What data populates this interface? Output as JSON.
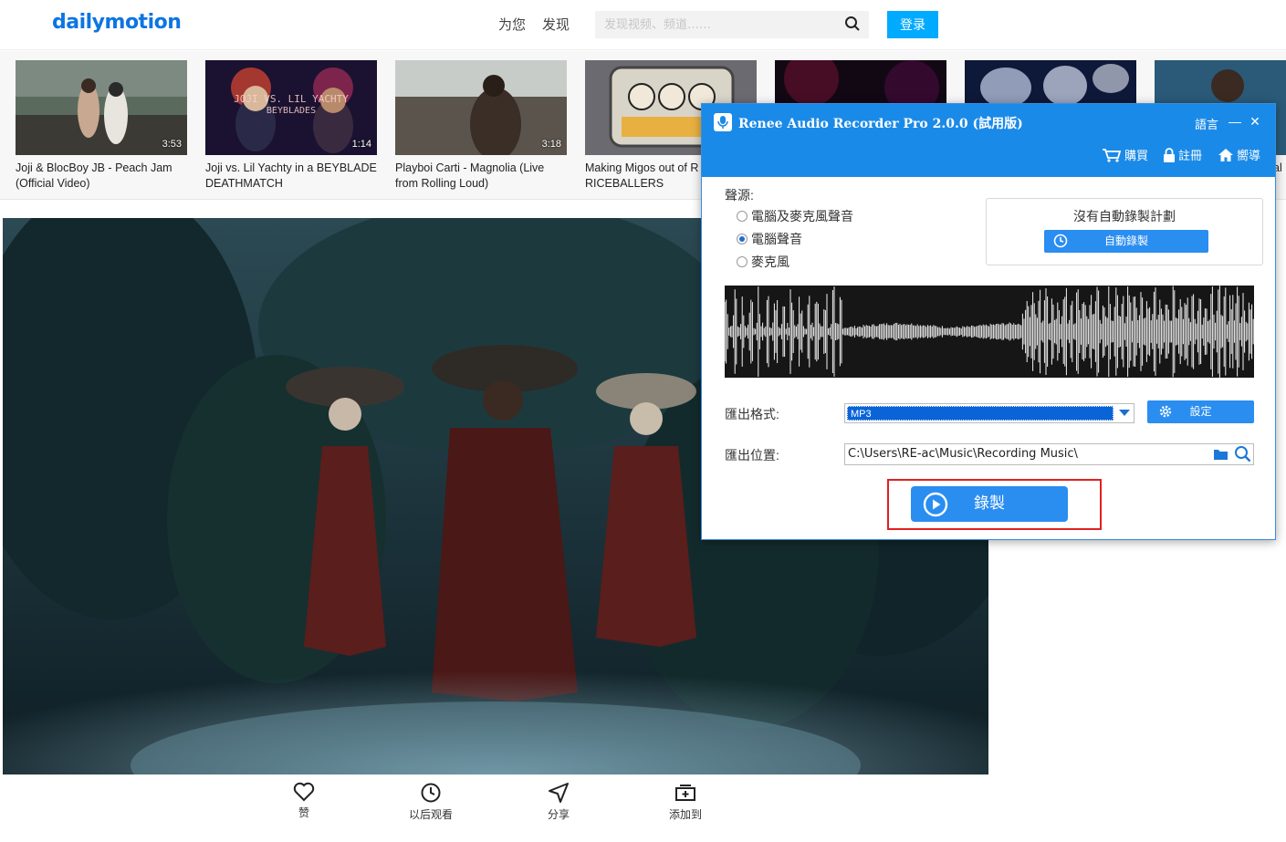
{
  "site": {
    "logo": "dailymotion",
    "nav": [
      "为您",
      "发现"
    ],
    "search_placeholder": "发现视频、频道……",
    "login_label": "登录"
  },
  "thumbnails": [
    {
      "title": "Joji & BlocBoy JB - Peach Jam\n(Official Video)",
      "duration": "3:53"
    },
    {
      "title": "Joji vs. Lil Yachty in a BEYBLADE\nDEATHMATCH",
      "duration": "1:14"
    },
    {
      "title": "Playboi Carti - Magnolia (Live\nfrom Rolling Loud)",
      "duration": "3:18"
    },
    {
      "title": "Making Migos out of R\nRICEBALLERS",
      "duration": ""
    },
    {
      "title": "",
      "duration": ""
    },
    {
      "title": "",
      "duration": ""
    },
    {
      "title": "al",
      "duration": ""
    }
  ],
  "player_actions": [
    {
      "label": "赞",
      "icon": "heart-icon"
    },
    {
      "label": "以后观看",
      "icon": "clock-icon"
    },
    {
      "label": "分享",
      "icon": "send-icon"
    },
    {
      "label": "添加到",
      "icon": "add-to-playlist-icon"
    }
  ],
  "recorder": {
    "title": "Renee Audio Recorder Pro 2.0.0 (試用版)",
    "language_label": "語言",
    "toolbar": {
      "buy": "購買",
      "register": "註冊",
      "home": "嚮導"
    },
    "source_label": "聲源:",
    "sources": [
      {
        "label": "電腦及麥克風聲音",
        "checked": false
      },
      {
        "label": "電腦聲音",
        "checked": true
      },
      {
        "label": "麥克風",
        "checked": false
      }
    ],
    "schedule_text": "沒有自動錄製計劃",
    "auto_record_label": "自動錄製",
    "format_label": "匯出格式:",
    "format_value": "MP3",
    "settings_label": "設定",
    "location_label": "匯出位置:",
    "location_value": "C:\\Users\\RE-ac\\Music\\Recording Music\\",
    "record_label": "錄製",
    "accent_color": "#1a8ae8",
    "highlight_color": "#e02020"
  }
}
